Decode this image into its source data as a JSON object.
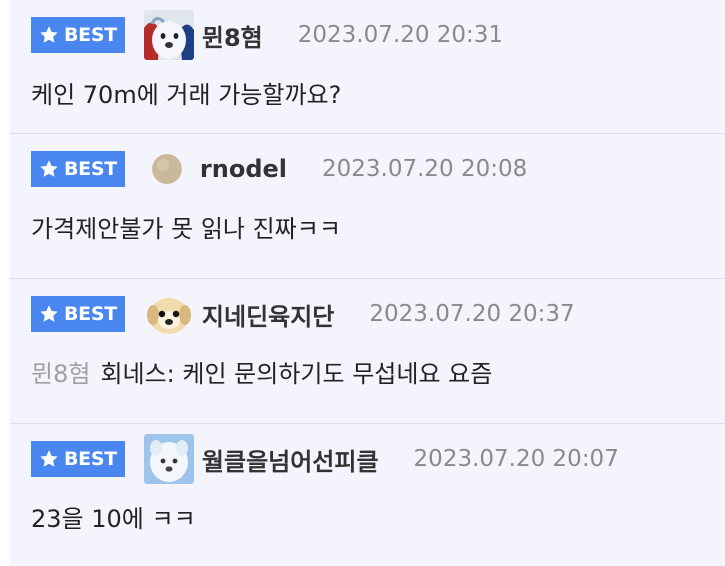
{
  "badge_label": "BEST",
  "colors": {
    "badge_bg": "#4a86f0",
    "list_bg": "#f4f5fc",
    "divider": "#dcdee8",
    "date": "#8a8a8a"
  },
  "comments": [
    {
      "author": "뮌8혐",
      "avatar": "white-puppy-avatar-icon",
      "date": "2023.07.20 20:31",
      "text": "케인 70m에 거래 가능할까요?"
    },
    {
      "author": "rnodel",
      "avatar": "tan-circle-avatar-icon",
      "date": "2023.07.20 20:08",
      "text": "가격제안불가 못 읽나 진짜ㅋㅋ"
    },
    {
      "author": "지네딘육지단",
      "avatar": "puppy-face-avatar-icon",
      "date": "2023.07.20 20:37",
      "reply_to": "뮌8혐",
      "text": "회네스: 케인 문의하기도 무섭네요 요즘"
    },
    {
      "author": "월클을넘어선피클",
      "avatar": "white-dog-avatar-icon",
      "date": "2023.07.20 20:07",
      "text": "23을 10에 ㅋㅋ"
    }
  ]
}
